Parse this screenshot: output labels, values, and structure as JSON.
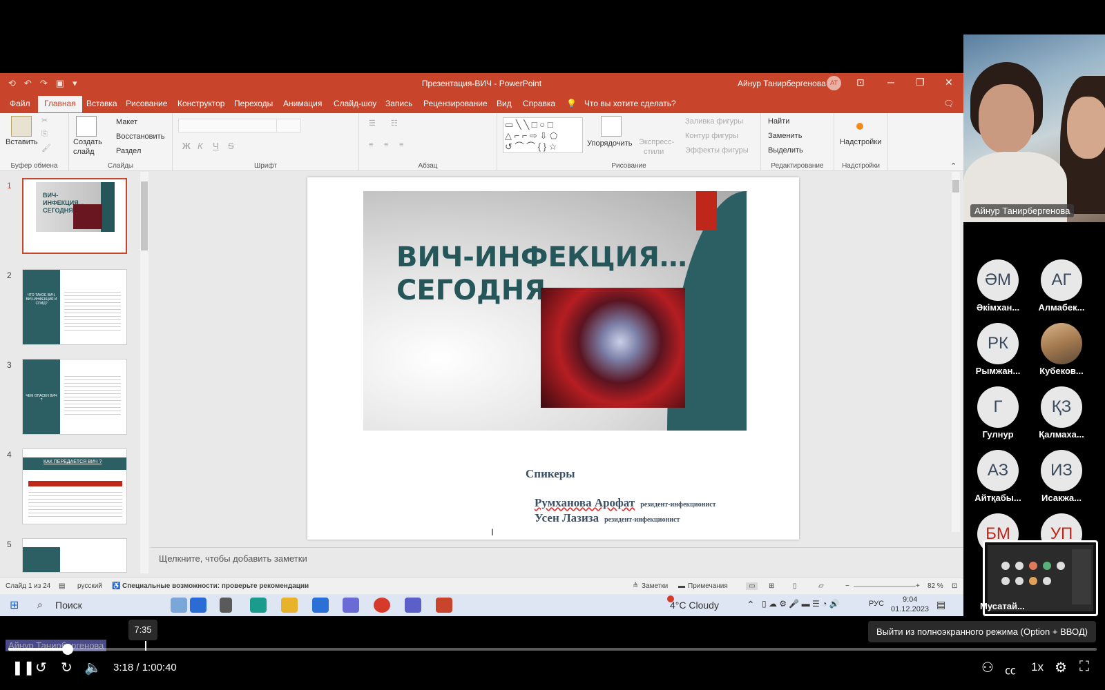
{
  "app": {
    "doc_title": "Презентация-ВИЧ  -  PowerPoint",
    "user_name": "Айнур Танирбергенова",
    "user_initials": "АТ"
  },
  "menu": {
    "tabs": [
      "Файл",
      "Главная",
      "Вставка",
      "Рисование",
      "Конструктор",
      "Переходы",
      "Анимация",
      "Слайд-шоу",
      "Запись",
      "Рецензирование",
      "Вид",
      "Справка"
    ],
    "tell_me": "Что вы хотите сделать?"
  },
  "ribbon": {
    "paste": "Вставить",
    "clipboard_group": "Буфер обмена",
    "new_slide_1": "Создать",
    "new_slide_2": "слайд",
    "layout": "Макет",
    "reset": "Восстановить",
    "section": "Раздел",
    "slides_group": "Слайды",
    "font_group": "Шрифт",
    "paragraph_group": "Абзац",
    "arrange": "Упорядочить",
    "quick_styles_1": "Экспресс-",
    "quick_styles_2": "стили",
    "shape_fill": "Заливка фигуры",
    "shape_outline": "Контур фигуры",
    "shape_effects": "Эффекты фигуры",
    "drawing_group": "Рисование",
    "find": "Найти",
    "replace": "Заменить",
    "select": "Выделить",
    "editing_group": "Редактирование",
    "addins": "Надстройки",
    "addins_group": "Надстройки",
    "bold": "Ж",
    "italic": "К",
    "underline": "Ч",
    "strike": "S"
  },
  "thumbnails": [
    {
      "num": "1",
      "title": "ВИЧ-ИНФЕКЦИЯ... СЕГОДНЯ"
    },
    {
      "num": "2",
      "title": "ЧТО ТАКОЕ ВИЧ, ВИЧ-ИНФЕКЦИЯ И СПИД?"
    },
    {
      "num": "3",
      "title": "ЧЕМ ОПАСЕН ВИЧ ?"
    },
    {
      "num": "4",
      "title": "КАК ПЕРЕДАЕТСЯ ВИЧ ?"
    },
    {
      "num": "5",
      "title": ""
    }
  ],
  "slide": {
    "title": "ВИЧ-ИНФЕКЦИЯ…\nСЕГОДНЯ",
    "speakers_heading": "Спикеры",
    "speaker1_name": "Румханова Арофат",
    "speaker1_role": "резидент-инфекционист",
    "speaker2_name": "Усен Лазиза",
    "speaker2_role": "резидент-инфекционист"
  },
  "notes_placeholder": "Щелкните, чтобы добавить заметки",
  "status": {
    "slide_counter": "Слайд 1 из 24",
    "language": "русский",
    "accessibility": "Специальные возможности: проверьте рекомендации",
    "notes": "Заметки",
    "comments": "Примечания",
    "zoom": "82 %"
  },
  "taskbar": {
    "search": "Поиск",
    "weather": "4°C  Cloudy",
    "lang": "РУС",
    "time": "9:04",
    "date": "01.12.2023"
  },
  "participants": {
    "speaker_label": "Айнур Танирбергенова",
    "list": [
      {
        "initials": "ӘМ",
        "name": "Әкімхан..."
      },
      {
        "initials": "АГ",
        "name": "Алмабек..."
      },
      {
        "initials": "РК",
        "name": "Рымжан..."
      },
      {
        "initials": "",
        "name": "Кубеков..."
      },
      {
        "initials": "Г",
        "name": "Гулнур"
      },
      {
        "initials": "ҚЗ",
        "name": "Қалмаха..."
      },
      {
        "initials": "АЗ",
        "name": "Айтқабы..."
      },
      {
        "initials": "ИЗ",
        "name": "Исакжа..."
      },
      {
        "initials": "БМ",
        "name": ""
      },
      {
        "initials": "УП",
        "name": ""
      }
    ],
    "last_name": "Мусатай..."
  },
  "player": {
    "hover_time": "7:35",
    "speaker_caption": "Айнур Танирбергенова",
    "current_time": "3:18",
    "separator": " / ",
    "duration": "1:00:40",
    "progress_fraction": 0.0544,
    "tooltip": "Выйти из полноэкранного режима (Option + ВВОД)",
    "speed": "1x"
  },
  "colors": {
    "office_accent": "#c8452b",
    "slide_teal": "#24565a",
    "slide_red": "#c0271b"
  }
}
